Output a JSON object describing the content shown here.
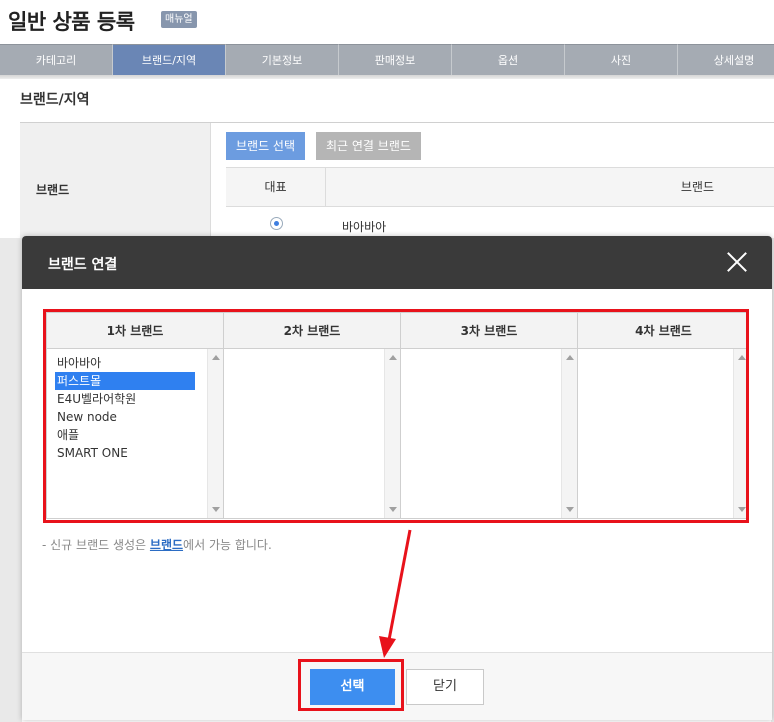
{
  "page": {
    "title": "일반 상품 등록",
    "manual_badge": "매뉴얼"
  },
  "tabs": [
    {
      "label": "카테고리",
      "active": false
    },
    {
      "label": "브랜드/지역",
      "active": true
    },
    {
      "label": "기본정보",
      "active": false
    },
    {
      "label": "판매정보",
      "active": false
    },
    {
      "label": "옵션",
      "active": false
    },
    {
      "label": "사진",
      "active": false
    },
    {
      "label": "상세설명",
      "active": false
    }
  ],
  "section": {
    "title": "브랜드/지역",
    "brand_label": "브랜드",
    "brand_select_button": "브랜드 선택",
    "recent_brand_button": "최근 연결 브랜드",
    "table_header_rep": "대표",
    "table_header_brand": "브랜드",
    "row_brand": "바아바아"
  },
  "modal": {
    "title": "브랜드 연결",
    "columns": [
      {
        "header": "1차 브랜드",
        "items": [
          "바아바아",
          "퍼스트몰",
          "E4U벨라어학원",
          "New node",
          "애플",
          "SMART ONE"
        ],
        "selected_index": 1
      },
      {
        "header": "2차 브랜드",
        "items": []
      },
      {
        "header": "3차 브랜드",
        "items": []
      },
      {
        "header": "4차 브랜드",
        "items": []
      }
    ],
    "help_prefix": "-  신규 브랜드 생성은 ",
    "help_link": "브랜드",
    "help_suffix": "에서 가능 합니다.",
    "select_button": "선택",
    "close_button": "닫기"
  },
  "colors": {
    "highlight": "#e8121b",
    "primary": "#3d8ef0",
    "active_tab": "#6a86b5"
  }
}
